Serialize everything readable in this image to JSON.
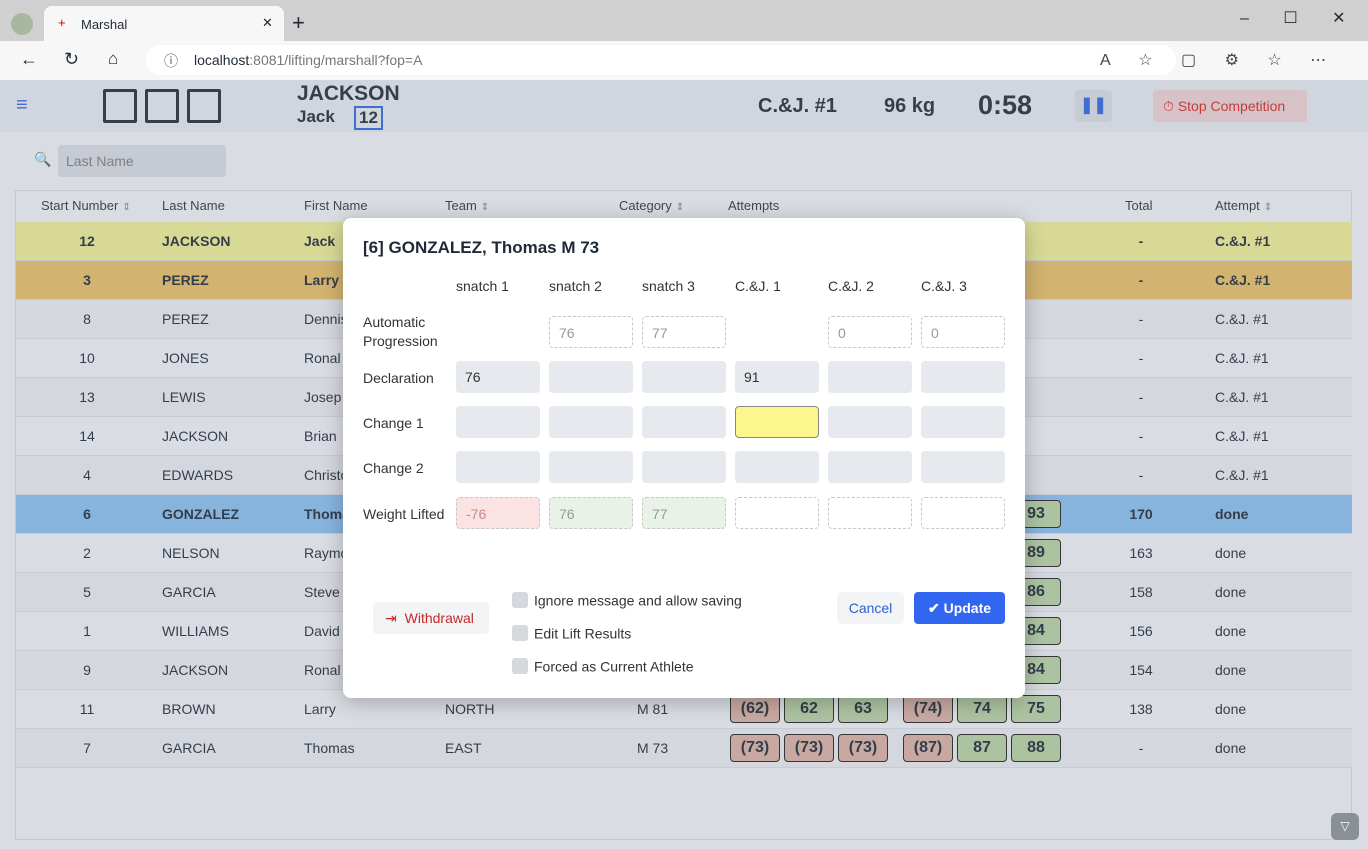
{
  "browser": {
    "tab_title": "Marshal",
    "url_host": "localhost",
    "url_rest": ":8081/lifting/marshall?fop=A"
  },
  "header": {
    "last_name": "JACKSON",
    "first_name": "Jack",
    "start_number": "12",
    "attempt": "C.&J. #1",
    "weight": "96 kg",
    "clock": "0:58",
    "stop_label": "Stop Competition"
  },
  "search": {
    "placeholder": "Last Name"
  },
  "columns": [
    "Start Number",
    "Last Name",
    "First Name",
    "Team",
    "Category",
    "Attempts",
    "Total",
    "Attempt"
  ],
  "rows": [
    {
      "n": "12",
      "last": "JACKSON",
      "first": "Jack",
      "total": "-",
      "att": "C.&J. #1",
      "bg": "#dcdb8e",
      "bold": true
    },
    {
      "n": "3",
      "last": "PEREZ",
      "first": "Larry",
      "total": "-",
      "att": "C.&J. #1",
      "bg": "#d4b062",
      "bold": true
    },
    {
      "n": "8",
      "last": "PEREZ",
      "first": "Dennis",
      "total": "-",
      "att": "C.&J. #1",
      "bg": "#d6d9df"
    },
    {
      "n": "10",
      "last": "JONES",
      "first": "Ronal",
      "total": "-",
      "att": "C.&J. #1",
      "bg": "#dcdfe4"
    },
    {
      "n": "13",
      "last": "LEWIS",
      "first": "Josep",
      "total": "-",
      "att": "C.&J. #1",
      "bg": "#d6d9df"
    },
    {
      "n": "14",
      "last": "JACKSON",
      "first": "Brian",
      "total": "-",
      "att": "C.&J. #1",
      "bg": "#dcdfe4"
    },
    {
      "n": "4",
      "last": "EDWARDS",
      "first": "Christo",
      "total": "-",
      "att": "C.&J. #1",
      "bg": "#d6d9df"
    },
    {
      "n": "6",
      "last": "GONZALEZ",
      "first": "Thoma",
      "total": "170",
      "att": "done",
      "bg": "#7fb1df",
      "bold": true,
      "cj3": "93"
    },
    {
      "n": "2",
      "last": "NELSON",
      "first": "Raymo",
      "total": "163",
      "att": "done",
      "bg": "#dcdfe4",
      "cj3": "89"
    },
    {
      "n": "5",
      "last": "GARCIA",
      "first": "Steve",
      "total": "158",
      "att": "done",
      "bg": "#d6d9df",
      "cj3": "86"
    },
    {
      "n": "1",
      "last": "WILLIAMS",
      "first": "David",
      "total": "156",
      "att": "done",
      "bg": "#dcdfe4",
      "cj3": "84"
    },
    {
      "n": "9",
      "last": "JACKSON",
      "first": "Ronal",
      "total": "154",
      "att": "done",
      "bg": "#d6d9df",
      "cj3": "84"
    },
    {
      "n": "11",
      "last": "BROWN",
      "first": "Larry",
      "team": "NORTH",
      "cat": "M 81",
      "total": "138",
      "att": "done",
      "bg": "#dcdfe4",
      "lifts": [
        [
          "(62)",
          "r"
        ],
        [
          "62",
          "g"
        ],
        [
          "63",
          "g"
        ],
        [
          "(74)",
          "r"
        ],
        [
          "74",
          "g"
        ],
        [
          "75",
          "g"
        ]
      ]
    },
    {
      "n": "7",
      "last": "GARCIA",
      "first": "Thomas",
      "team": "EAST",
      "cat": "M 73",
      "total": "-",
      "att": "done",
      "bg": "#d6d9df",
      "lifts": [
        [
          "(73)",
          "r"
        ],
        [
          "(73)",
          "r"
        ],
        [
          "(73)",
          "r"
        ],
        [
          "(87)",
          "r"
        ],
        [
          "87",
          "g"
        ],
        [
          "88",
          "g"
        ]
      ]
    }
  ],
  "dialog": {
    "title": "[6] GONZALEZ, Thomas M 73",
    "cols": [
      "snatch 1",
      "snatch 2",
      "snatch 3",
      "C.&J. 1",
      "C.&J. 2",
      "C.&J. 3"
    ],
    "grid": [
      {
        "label": "Automatic Progression",
        "cells": [
          null,
          "76",
          "77",
          null,
          "0",
          "0"
        ],
        "style": "d"
      },
      {
        "label": "Declaration",
        "cells": [
          "76",
          "",
          "",
          "91",
          "",
          ""
        ],
        "style": "f"
      },
      {
        "label": "Change 1",
        "cells": [
          "",
          "",
          "",
          "",
          "",
          ""
        ],
        "style": "f",
        "highlight": 3
      },
      {
        "label": "Change 2",
        "cells": [
          "",
          "",
          "",
          "",
          "",
          ""
        ],
        "style": "f"
      },
      {
        "label": "Weight Lifted",
        "cells": [
          "-76",
          "76",
          "77",
          "",
          "",
          ""
        ],
        "style": "d",
        "colors": [
          "#fbe3e3",
          "#e8f2e6",
          "#e8f2e6"
        ]
      }
    ],
    "withdrawal": "Withdrawal",
    "checks": [
      "Ignore message and allow saving",
      "Edit Lift Results",
      "Forced as Current Athlete"
    ],
    "cancel": "Cancel",
    "update": "Update"
  }
}
